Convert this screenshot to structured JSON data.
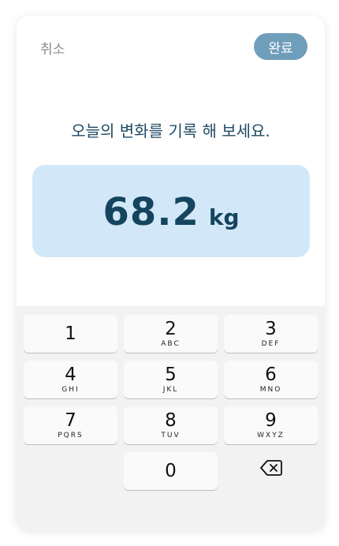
{
  "header": {
    "cancel_label": "취소",
    "done_label": "완료"
  },
  "prompt": "오늘의 변화를 기록 해 보세요.",
  "weight": {
    "value": "68.2",
    "unit": "kg"
  },
  "keypad": {
    "keys": [
      {
        "digit": "1",
        "letters": ""
      },
      {
        "digit": "2",
        "letters": "ABC"
      },
      {
        "digit": "3",
        "letters": "DEF"
      },
      {
        "digit": "4",
        "letters": "GHI"
      },
      {
        "digit": "5",
        "letters": "JKL"
      },
      {
        "digit": "6",
        "letters": "MNO"
      },
      {
        "digit": "7",
        "letters": "PQRS"
      },
      {
        "digit": "8",
        "letters": "TUV"
      },
      {
        "digit": "9",
        "letters": "WXYZ"
      },
      {
        "digit": "0",
        "letters": ""
      }
    ],
    "backspace_icon": "backspace-icon"
  }
}
